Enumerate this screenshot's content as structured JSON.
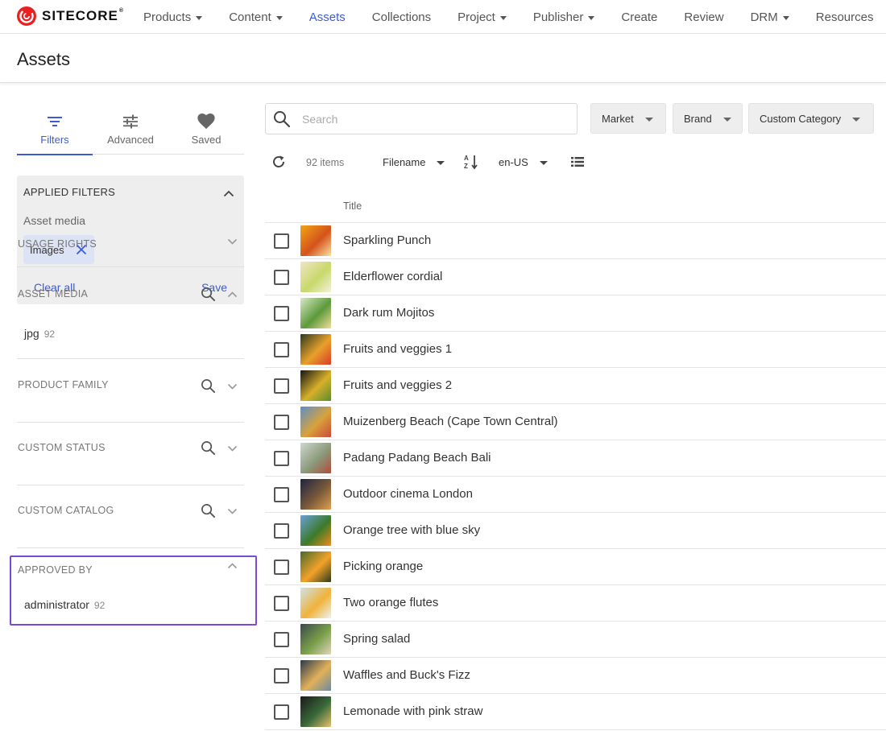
{
  "brand": {
    "logo_text": "SITECORE",
    "registered": "®",
    "accent": "#eb1f1f"
  },
  "nav": {
    "items": [
      {
        "label": "Products",
        "dropdown": true,
        "active": false
      },
      {
        "label": "Content",
        "dropdown": true,
        "active": false
      },
      {
        "label": "Assets",
        "dropdown": false,
        "active": true
      },
      {
        "label": "Collections",
        "dropdown": false,
        "active": false
      },
      {
        "label": "Project",
        "dropdown": true,
        "active": false
      },
      {
        "label": "Publisher",
        "dropdown": true,
        "active": false
      },
      {
        "label": "Create",
        "dropdown": false,
        "active": false
      },
      {
        "label": "Review",
        "dropdown": false,
        "active": false
      },
      {
        "label": "DRM",
        "dropdown": true,
        "active": false
      },
      {
        "label": "Resources",
        "dropdown": false,
        "active": false
      }
    ],
    "active_color": "#3b5bd9"
  },
  "page": {
    "title": "Assets"
  },
  "sidebar": {
    "tabs": [
      {
        "label": "Filters",
        "icon": "filter-icon",
        "active": true
      },
      {
        "label": "Advanced",
        "icon": "sliders-icon",
        "active": false
      },
      {
        "label": "Saved",
        "icon": "heart-icon",
        "active": false
      }
    ],
    "applied_filters": {
      "title": "APPLIED FILTERS",
      "subtitle": "Asset media",
      "chip_label": "Images",
      "clear_all": "Clear all",
      "save": "Save"
    },
    "facets": [
      {
        "title": "USAGE RIGHTS",
        "search": false,
        "expanded": false,
        "values": []
      },
      {
        "title": "ASSET MEDIA",
        "search": true,
        "expanded": true,
        "values": [
          {
            "label": "jpg",
            "count": "92"
          }
        ]
      },
      {
        "title": "PRODUCT FAMILY",
        "search": true,
        "expanded": false,
        "values": []
      },
      {
        "title": "CUSTOM STATUS",
        "search": true,
        "expanded": false,
        "values": []
      },
      {
        "title": "CUSTOM CATALOG",
        "search": true,
        "expanded": false,
        "values": []
      },
      {
        "title": "APPROVED BY",
        "search": false,
        "expanded": true,
        "values": [
          {
            "label": "administrator",
            "count": "92"
          }
        ]
      }
    ],
    "highlight_color": "#7a49d6"
  },
  "main": {
    "search": {
      "placeholder": "Search",
      "value": ""
    },
    "filters": [
      {
        "label": "Market"
      },
      {
        "label": "Brand"
      },
      {
        "label": "Custom Category"
      }
    ],
    "toolbar": {
      "count": "92 items",
      "sort_field": "Filename",
      "locale": "en-US"
    },
    "table": {
      "column_title": "Title",
      "rows": [
        {
          "title": "Sparkling Punch",
          "thumb": [
            "#f2a516",
            "#d4531b",
            "#fbe0a0"
          ]
        },
        {
          "title": "Elderflower cordial",
          "thumb": [
            "#efe6c4",
            "#c8d96a",
            "#f5f0dc"
          ]
        },
        {
          "title": "Dark rum Mojitos",
          "thumb": [
            "#d7e8c4",
            "#5c9a3a",
            "#f2dd9a"
          ]
        },
        {
          "title": "Fruits and veggies 1",
          "thumb": [
            "#2b3a1e",
            "#e9a02a",
            "#d93b2b"
          ]
        },
        {
          "title": "Fruits and veggies 2",
          "thumb": [
            "#141414",
            "#d8b02a",
            "#5a8a2e"
          ]
        },
        {
          "title": "Muizenberg Beach (Cape Town Central)",
          "thumb": [
            "#5a8fc9",
            "#d9a23b",
            "#c94a3b"
          ]
        },
        {
          "title": "Padang Padang Beach Bali",
          "thumb": [
            "#cfd6d0",
            "#8a9a7a",
            "#b24a3a"
          ]
        },
        {
          "title": "Outdoor cinema London",
          "thumb": [
            "#1c2440",
            "#7a5a3a",
            "#e0a050"
          ]
        },
        {
          "title": "Orange tree with blue sky",
          "thumb": [
            "#6aa0d8",
            "#3c7a2a",
            "#f08a1a"
          ]
        },
        {
          "title": "Picking orange",
          "thumb": [
            "#4a6a2a",
            "#f3a22a",
            "#2a3a1a"
          ]
        },
        {
          "title": "Two orange flutes",
          "thumb": [
            "#cfe3ea",
            "#f0b23a",
            "#eef4f0"
          ]
        },
        {
          "title": "Spring salad",
          "thumb": [
            "#3a4a4a",
            "#7aa04a",
            "#e2d5c0"
          ]
        },
        {
          "title": "Waffles and Buck's Fizz",
          "thumb": [
            "#2a3a4a",
            "#e2b05a",
            "#6a8aa0"
          ]
        },
        {
          "title": "Lemonade with pink straw",
          "thumb": [
            "#1a1a1a",
            "#3a6a3a",
            "#e8c06a"
          ]
        }
      ]
    }
  }
}
